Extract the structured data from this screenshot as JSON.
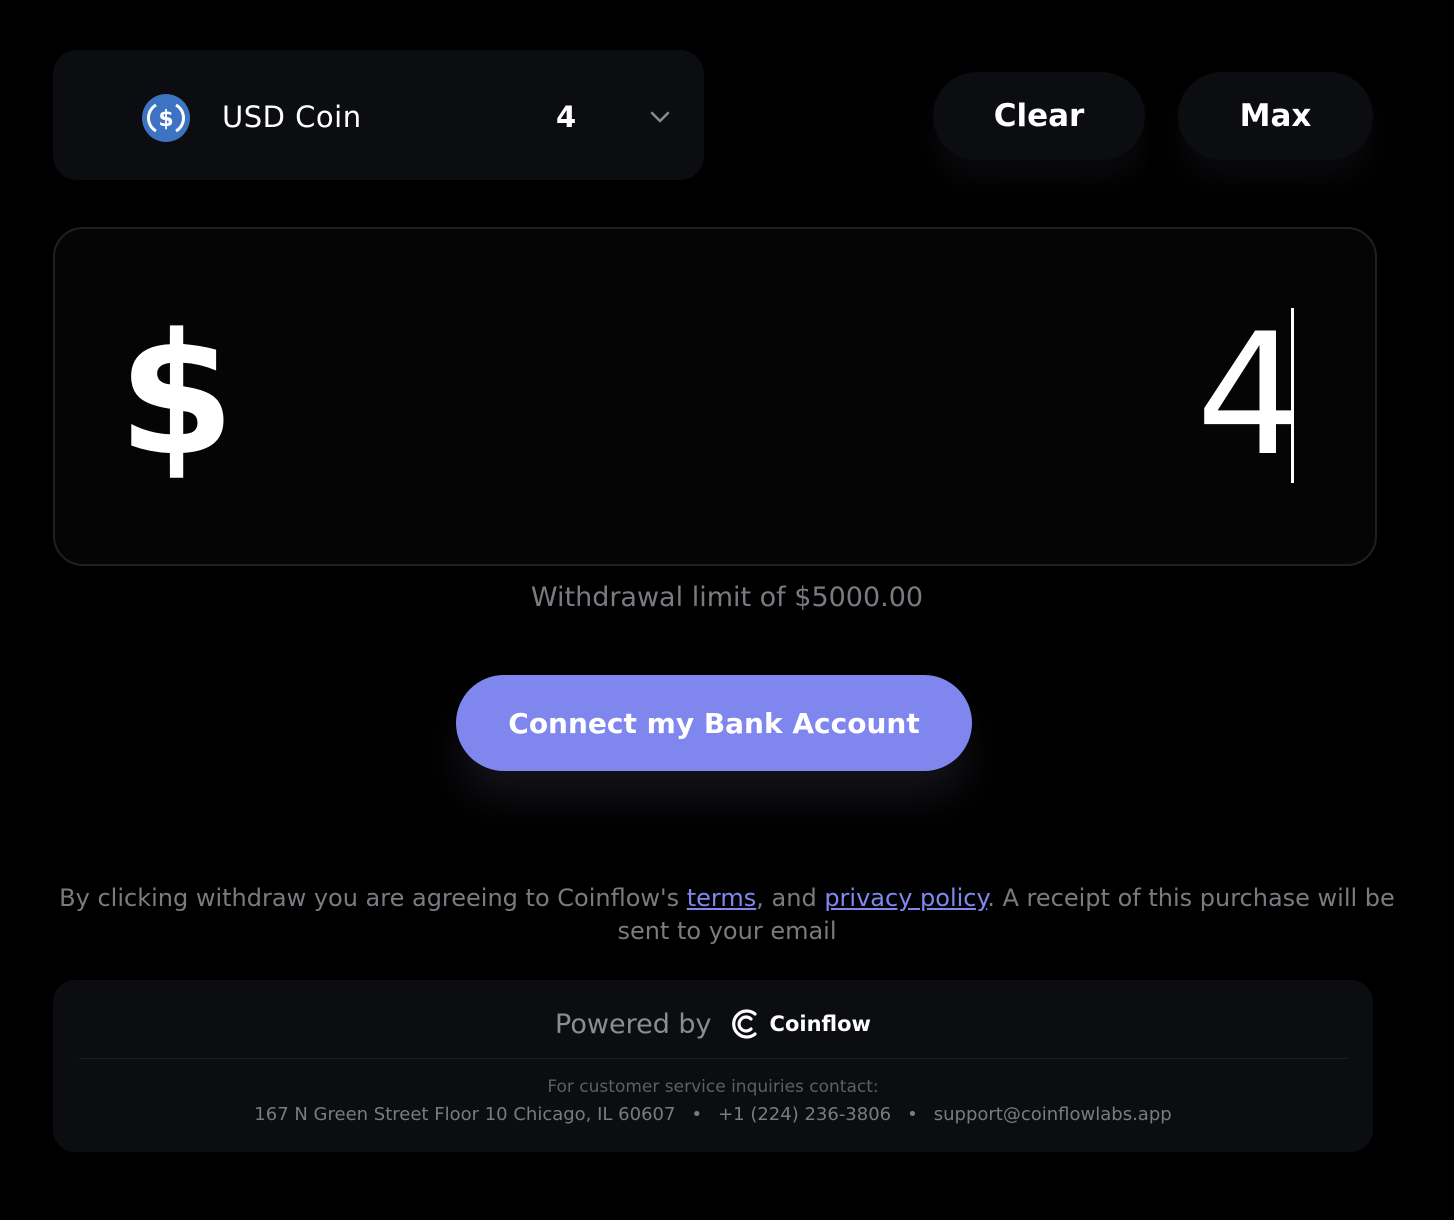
{
  "token": {
    "name": "USD Coin",
    "balance": "4",
    "icon": "usdc-icon",
    "icon_color": "#3e73c4"
  },
  "actions": {
    "clear_label": "Clear",
    "max_label": "Max"
  },
  "amount": {
    "currency_symbol": "$",
    "value": "4"
  },
  "limit_text": "Withdrawal limit of $5000.00",
  "connect_label": "Connect my Bank Account",
  "connect_color": "#7f86ee",
  "terms": {
    "prefix": "By clicking withdraw you are agreeing to Coinflow's ",
    "terms_link": "terms",
    "middle": ", and ",
    "privacy_link": "privacy policy",
    "suffix": ". A receipt of this purchase will be sent to your email"
  },
  "footer": {
    "powered_by": "Powered by",
    "brand": "Coinflow",
    "contact_heading": "For customer service inquiries contact:",
    "address": "167 N Green Street Floor 10 Chicago, IL 60607",
    "phone": "+1 (224) 236-3806",
    "email": "support@coinflowlabs.app",
    "separator": "•"
  }
}
